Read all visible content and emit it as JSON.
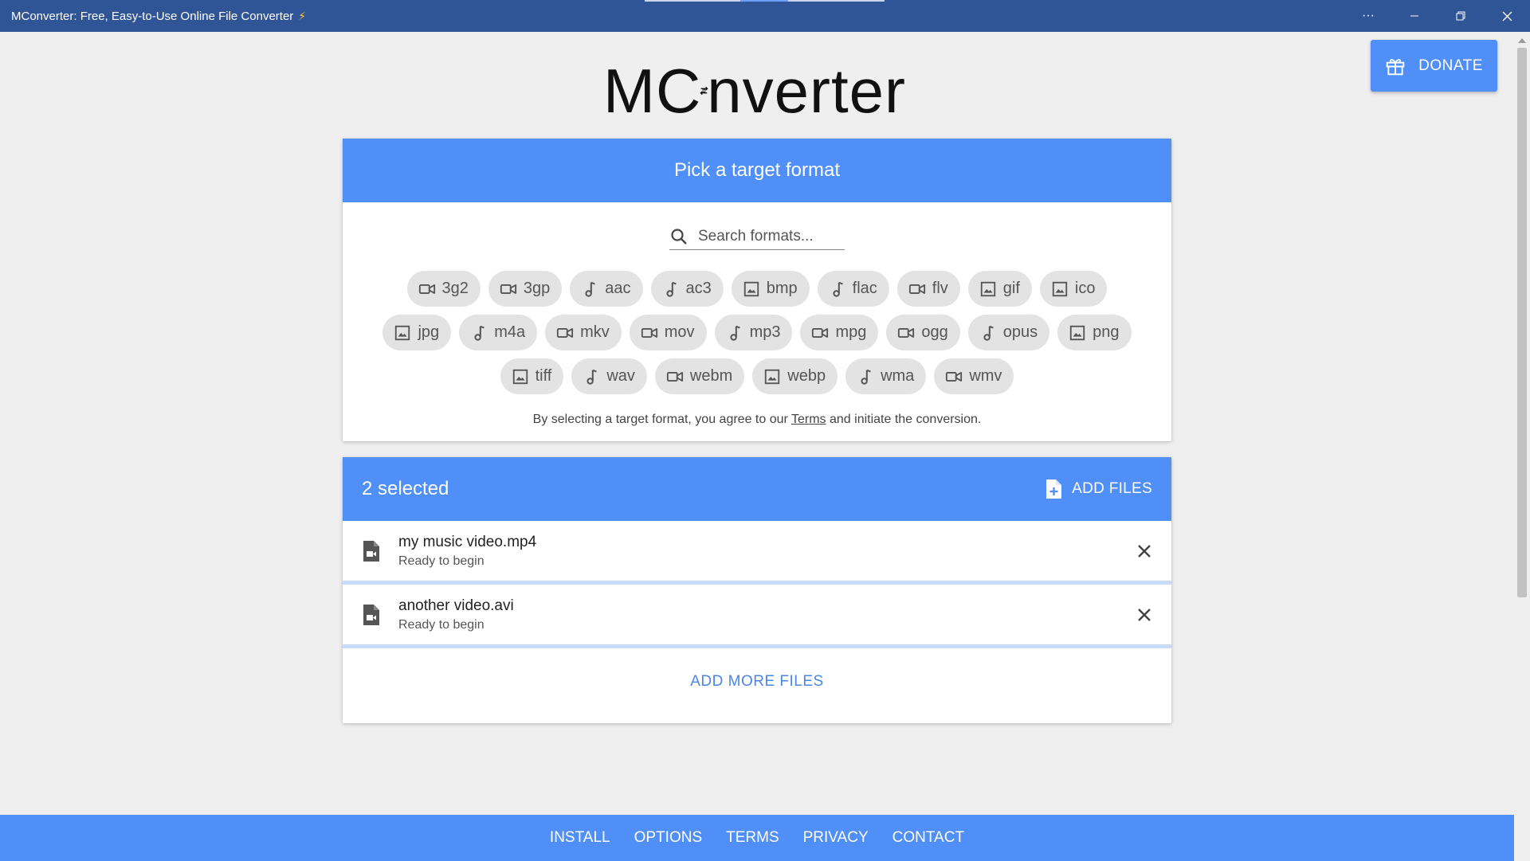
{
  "window": {
    "title": "MConverter: Free, Easy-to-Use Online File Converter",
    "controls": {
      "more": "···",
      "minimize": "—",
      "maximize": "❐",
      "close": "✕"
    }
  },
  "donate": {
    "label": "DONATE"
  },
  "logo": {
    "left": "MC",
    "right": "nverter"
  },
  "format_card": {
    "title": "Pick a target format",
    "search_placeholder": "Search formats...",
    "chips": [
      [
        {
          "label": "3g2",
          "icon": "video"
        },
        {
          "label": "3gp",
          "icon": "video"
        },
        {
          "label": "aac",
          "icon": "music"
        },
        {
          "label": "ac3",
          "icon": "music"
        },
        {
          "label": "bmp",
          "icon": "image"
        },
        {
          "label": "flac",
          "icon": "music"
        },
        {
          "label": "flv",
          "icon": "video"
        },
        {
          "label": "gif",
          "icon": "image"
        },
        {
          "label": "ico",
          "icon": "image"
        }
      ],
      [
        {
          "label": "jpg",
          "icon": "image"
        },
        {
          "label": "m4a",
          "icon": "music"
        },
        {
          "label": "mkv",
          "icon": "video"
        },
        {
          "label": "mov",
          "icon": "video"
        },
        {
          "label": "mp3",
          "icon": "music"
        },
        {
          "label": "mpg",
          "icon": "video"
        },
        {
          "label": "ogg",
          "icon": "video"
        },
        {
          "label": "opus",
          "icon": "music"
        },
        {
          "label": "png",
          "icon": "image"
        }
      ],
      [
        {
          "label": "tiff",
          "icon": "image"
        },
        {
          "label": "wav",
          "icon": "music"
        },
        {
          "label": "webm",
          "icon": "video"
        },
        {
          "label": "webp",
          "icon": "image"
        },
        {
          "label": "wma",
          "icon": "music"
        },
        {
          "label": "wmv",
          "icon": "video"
        }
      ]
    ],
    "agreement_before": "By selecting a target format, you agree to our ",
    "agreement_link": "Terms",
    "agreement_after": " and initiate the conversion."
  },
  "files_card": {
    "count": "2 selected",
    "add_files": "ADD FILES",
    "files": [
      {
        "name": "my music video.mp4",
        "status": "Ready to begin"
      },
      {
        "name": "another video.avi",
        "status": "Ready to begin"
      }
    ],
    "add_more": "ADD MORE FILES"
  },
  "footer": {
    "links": [
      "INSTALL",
      "OPTIONS",
      "TERMS",
      "PRIVACY",
      "CONTACT"
    ]
  },
  "colors": {
    "titlebar": "#2f5596",
    "accent": "#4f8ff7",
    "chip_bg": "#e3e3e3",
    "progress_track": "#c7dcfb"
  }
}
